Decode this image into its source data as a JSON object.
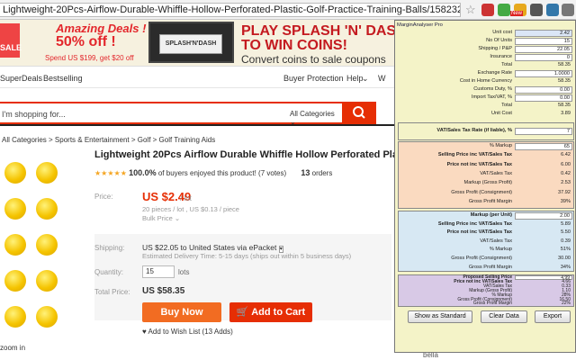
{
  "browser": {
    "url": "Lightweight-20Pcs-Airflow-Durable-Whiffle-Hollow-Perforated-Plastic-Golf-Practice-Training-Balls/1582322270.html",
    "ext_badge": "New"
  },
  "banner": {
    "sale_text": "SALE",
    "deal_line1": "Amazing Deals !",
    "deal_line2": "50% off !",
    "deal_line3": "Spend US $199, get $20 off",
    "game_label": "SPLASH'N'DASH",
    "promo_line1": "PLAY SPLASH 'N' DASH",
    "promo_line2": "TO WIN COINS!",
    "promo_line3": "Convert coins to sale coupons"
  },
  "nav": {
    "items": [
      "SuperDeals",
      "Bestselling"
    ],
    "buyer_protection": "Buyer Protection",
    "help": "Help",
    "wish": "W"
  },
  "search": {
    "placeholder": "I'm shopping for...",
    "category": "All Categories"
  },
  "breadcrumb": "All Categories > Sports & Entertainment > Golf > Golf Training Aids",
  "product": {
    "title": "Lightweight 20Pcs Airflow Durable Whiffle Hollow Perforated Plastic G",
    "stars": "★★★★★",
    "rating_pct": "100.0%",
    "rating_text": "of buyers enjoyed this product! (7 votes)",
    "orders_count": "13",
    "orders_label": "orders",
    "price_label": "Price:",
    "price": "US $2.49",
    "price_unit": "/ lot",
    "pieces": "20 pieces / lot , US $0.13 / piece",
    "bulk": "Bulk Price",
    "shipping_label": "Shipping:",
    "shipping": "US $22.05  to  United States via ePacket",
    "shipping_sub": "Estimated Delivery Time: 5-15 days (ships out within 5 business days)",
    "quantity_label": "Quantity:",
    "quantity": "15",
    "quantity_unit": "lots",
    "total_label": "Total Price:",
    "total": "US $58.35",
    "buy_now": "Buy Now",
    "add_to_cart": "Add to Cart",
    "wishlist": "Add to Wish List (13 Adds)",
    "zoom": "zoom in",
    "right_note": "bella"
  },
  "analyser": {
    "title": "MarginAnalyser Pro",
    "rows_top": [
      {
        "label": "Unit cost",
        "value": "2.42",
        "input": true,
        "blue": true
      },
      {
        "label": "No Of Units",
        "value": "15",
        "input": true,
        "blue": false
      },
      {
        "label": "Shipping / P&P",
        "value": "22.05",
        "input": true,
        "blue": false
      },
      {
        "label": "Insurance",
        "value": "0",
        "input": true,
        "blue": false
      },
      {
        "label": "Total",
        "value": "58.35",
        "input": false
      },
      {
        "label": "Exchange Rate",
        "value": "1.0000",
        "input": true,
        "blue": false
      },
      {
        "label": "Cost in Home Currency",
        "value": "58.35",
        "input": false
      },
      {
        "label": "Customs Duty, %",
        "value": "0.00",
        "input": true,
        "blue": false
      },
      {
        "label": "Import Tax/VAT, %",
        "value": "0.00",
        "input": true,
        "blue": false
      },
      {
        "label": "Total",
        "value": "58.35",
        "input": false
      },
      {
        "label": "Unit Cost",
        "value": "3.89",
        "input": false
      }
    ],
    "vat_rate": {
      "label": "VAT/Sales Tax Rate (if liable), %",
      "value": "7"
    },
    "section_markup": [
      {
        "label": "% Markup",
        "value": "65",
        "input": true,
        "blue": false,
        "bold": false
      },
      {
        "label": "Selling Price inc VAT/Sales Tax",
        "value": "6.42",
        "input": false,
        "bold": true
      },
      {
        "label": "Price not inc VAT/Sales Tax",
        "value": "6.00",
        "input": false,
        "bold": true
      },
      {
        "label": "VAT/Sales Tax",
        "value": "0.42",
        "input": false,
        "bold": false
      },
      {
        "label": "Markup (Gross Profit)",
        "value": "2.53",
        "input": false,
        "bold": false
      },
      {
        "label": "Gross Profit (Consignment)",
        "value": "37.92",
        "input": false,
        "bold": false
      },
      {
        "label": "Gross Profit Margin",
        "value": "39%",
        "input": false,
        "bold": false
      }
    ],
    "section_markup_unit": [
      {
        "label": "Markup (per Unit)",
        "value": "2.00",
        "input": true,
        "blue": false,
        "bold": true
      },
      {
        "label": "Selling Price inc VAT/Sales Tax",
        "value": "5.89",
        "input": false,
        "bold": true
      },
      {
        "label": "Price not inc VAT/Sales Tax",
        "value": "5.50",
        "input": false,
        "bold": true
      },
      {
        "label": "VAT/Sales Tax",
        "value": "0.39",
        "input": false,
        "bold": false
      },
      {
        "label": "% Markup",
        "value": "51%",
        "input": false,
        "bold": false
      },
      {
        "label": "Gross Profit (Consignment)",
        "value": "30.00",
        "input": false,
        "bold": false
      },
      {
        "label": "Gross Profit Margin",
        "value": "34%",
        "input": false,
        "bold": false
      }
    ],
    "section_price": [
      {
        "label": "Proposed Selling Price",
        "value": "4.99",
        "input": true,
        "blue": false,
        "bold": true
      },
      {
        "label": "Price not inc VAT/Sales Tax",
        "value": "4.66",
        "input": false,
        "bold": true
      },
      {
        "label": "VAT/Sales Tax",
        "value": "0.33",
        "input": false,
        "bold": false
      },
      {
        "label": "Markup (Gross Profit)",
        "value": "1.10",
        "input": false,
        "bold": false
      },
      {
        "label": "% Markup",
        "value": "28%",
        "input": false,
        "bold": false
      },
      {
        "label": "Gross Profit (Consignment)",
        "value": "16.50",
        "input": false,
        "bold": false
      },
      {
        "label": "Gross Profit Margin",
        "value": "22%",
        "input": false,
        "bold": false
      }
    ],
    "buttons": {
      "standard": "Show as Standard",
      "clear": "Clear Data",
      "export": "Export"
    }
  }
}
